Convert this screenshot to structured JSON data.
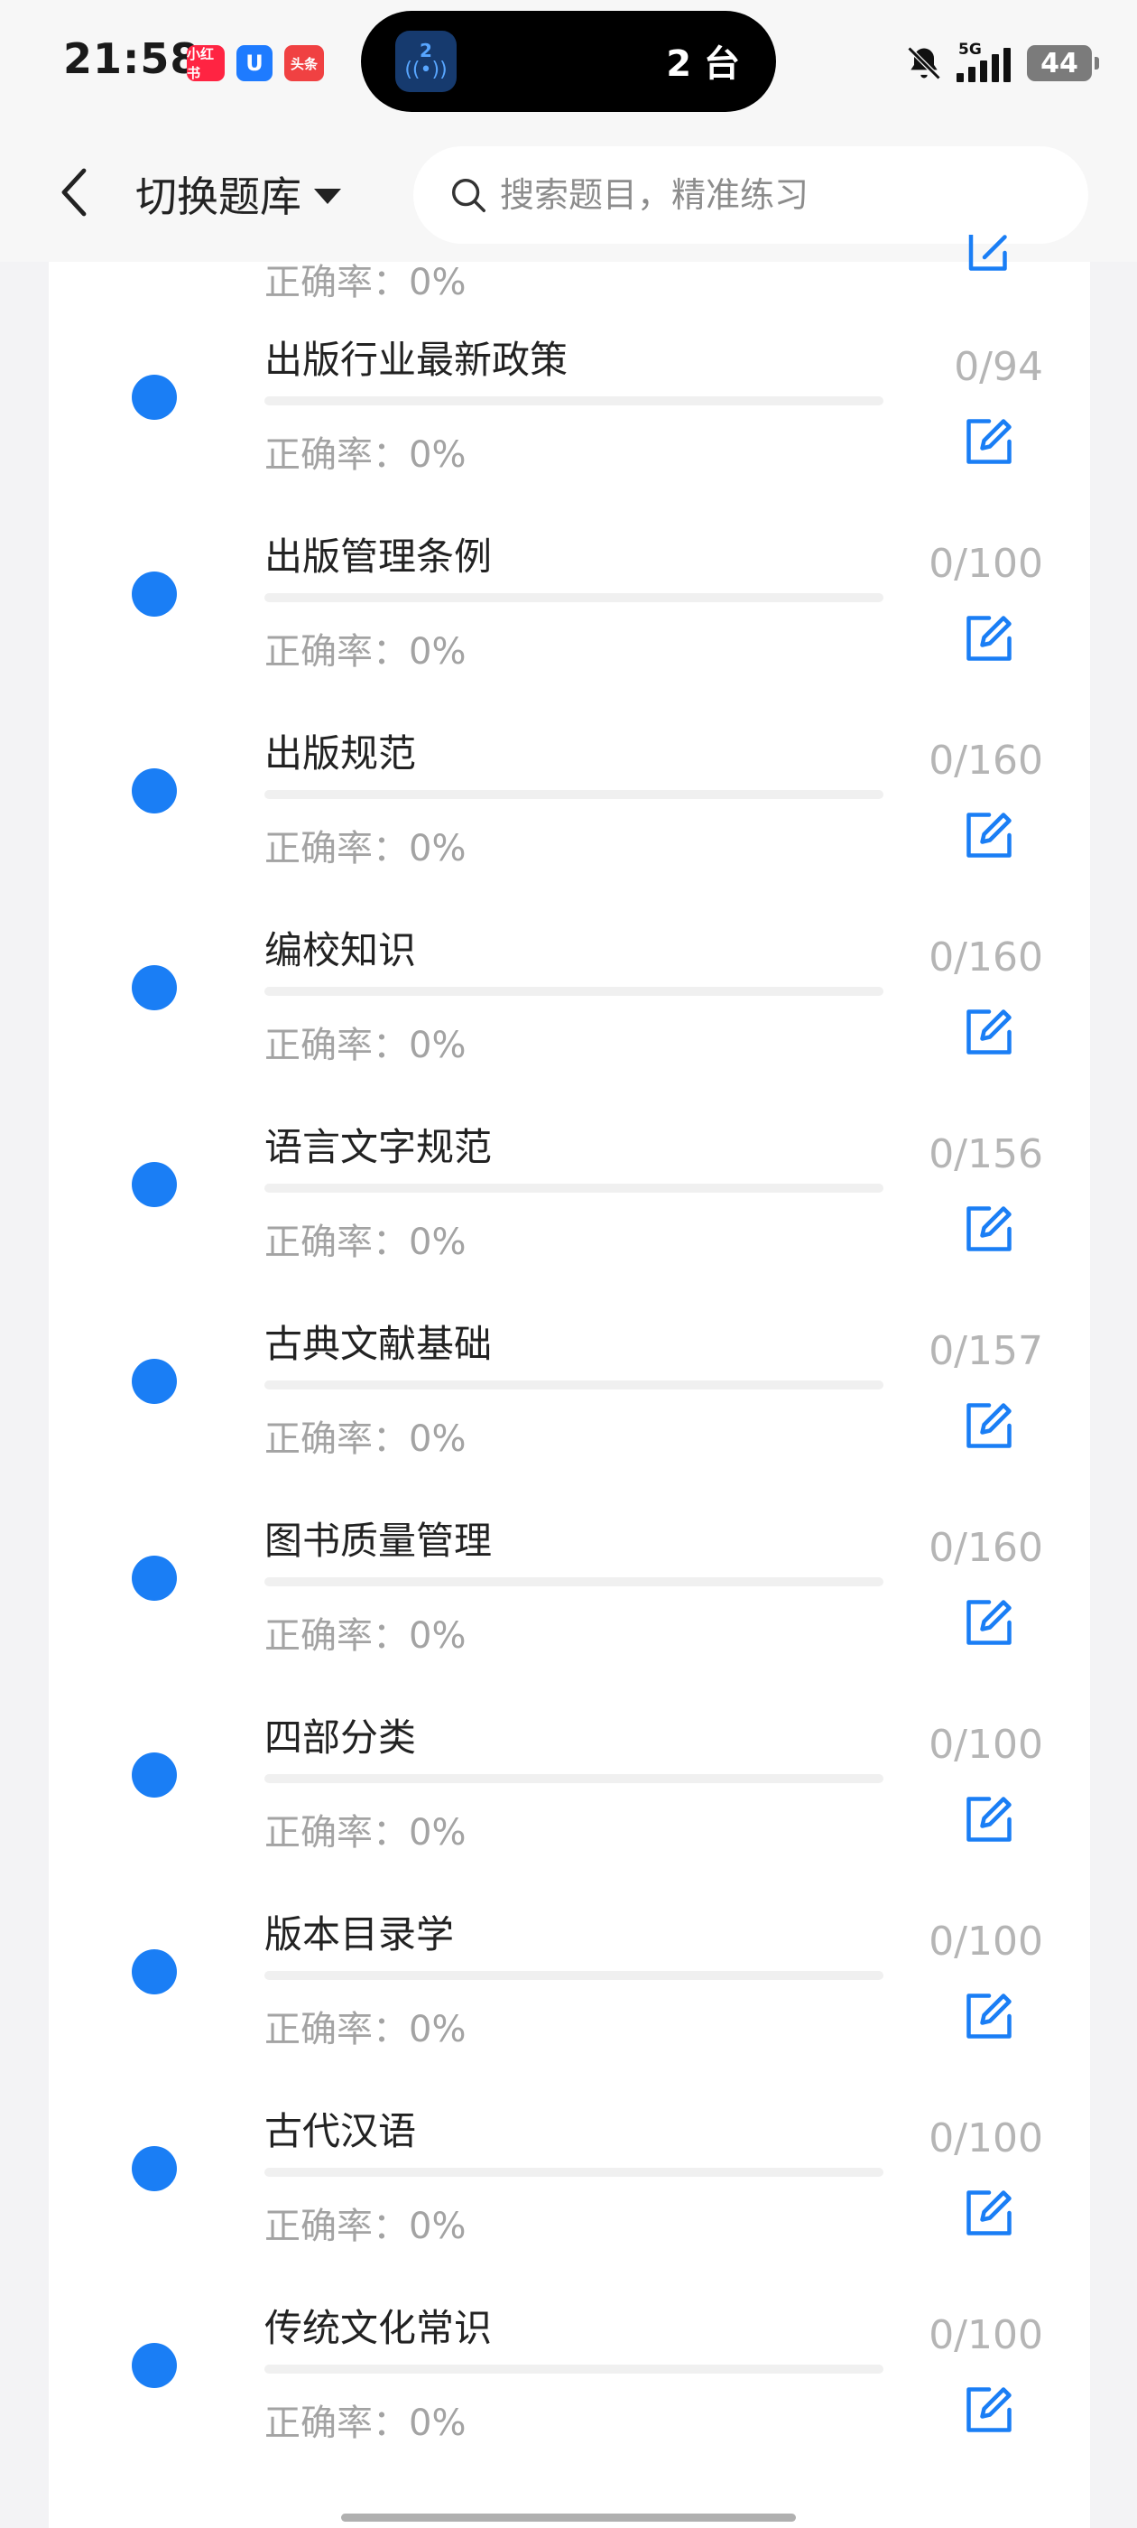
{
  "status_bar": {
    "time": "21:58",
    "apps": [
      {
        "name": "xiaohongshu-icon",
        "label": "小红书",
        "color": "#ff2442"
      },
      {
        "name": "u-app-icon",
        "label": "U",
        "color": "#1e7bff"
      },
      {
        "name": "toutiao-icon",
        "label": "头条",
        "color": "#f04142"
      }
    ],
    "island": {
      "badge": "2",
      "text": "2 台"
    },
    "network": "5G",
    "battery": "44",
    "icons": [
      "bell-muted-icon",
      "signal-icon",
      "battery-icon"
    ]
  },
  "header": {
    "back_icon": "chevron-left-icon",
    "switch_label": "切换题库",
    "search_placeholder": "搜索题目，精准练习"
  },
  "accent_color": "#1a7ef5",
  "partial_top": {
    "accuracy_label": "正确率：0%"
  },
  "items": [
    {
      "title": "出版行业最新政策",
      "accuracy_label": "正确率：0%",
      "count": "0/94",
      "progress": 0
    },
    {
      "title": "出版管理条例",
      "accuracy_label": "正确率：0%",
      "count": "0/100",
      "progress": 0
    },
    {
      "title": "出版规范",
      "accuracy_label": "正确率：0%",
      "count": "0/160",
      "progress": 0
    },
    {
      "title": "编校知识",
      "accuracy_label": "正确率：0%",
      "count": "0/160",
      "progress": 0
    },
    {
      "title": "语言文字规范",
      "accuracy_label": "正确率：0%",
      "count": "0/156",
      "progress": 0
    },
    {
      "title": "古典文献基础",
      "accuracy_label": "正确率：0%",
      "count": "0/157",
      "progress": 0
    },
    {
      "title": "图书质量管理",
      "accuracy_label": "正确率：0%",
      "count": "0/160",
      "progress": 0
    },
    {
      "title": "四部分类",
      "accuracy_label": "正确率：0%",
      "count": "0/100",
      "progress": 0
    },
    {
      "title": "版本目录学",
      "accuracy_label": "正确率：0%",
      "count": "0/100",
      "progress": 0
    },
    {
      "title": "古代汉语",
      "accuracy_label": "正确率：0%",
      "count": "0/100",
      "progress": 0
    },
    {
      "title": "传统文化常识",
      "accuracy_label": "正确率：0%",
      "count": "0/100",
      "progress": 0
    }
  ]
}
